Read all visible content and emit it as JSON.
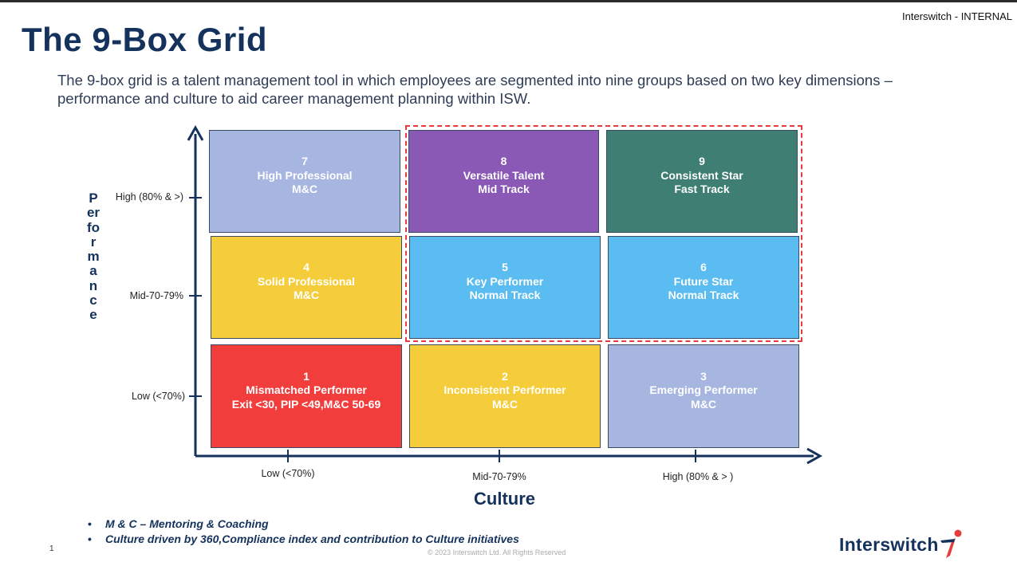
{
  "header": {
    "classification": "Interswitch - INTERNAL",
    "title": "The 9-Box Grid",
    "intro": "The 9-box grid is a talent management tool in which employees are segmented into nine groups based on two key dimensions – performance and culture to aid career management planning within ISW."
  },
  "axes": {
    "y_title": "Performance",
    "y_ticks": [
      "High (80% & >)",
      "Mid-70-79%",
      "Low (<70%)"
    ],
    "x_title": "Culture",
    "x_ticks": [
      "Low (<70%)",
      "Mid-70-79%",
      "High (80% & > )"
    ]
  },
  "boxes": [
    {
      "number": "7",
      "title": "High Professional",
      "subtitle": "M&C",
      "color": "#a7b6e1"
    },
    {
      "number": "8",
      "title": "Versatile Talent",
      "subtitle": "Mid Track",
      "color": "#8a59b5"
    },
    {
      "number": "9",
      "title": "Consistent Star",
      "subtitle": "Fast Track",
      "color": "#3f7f73"
    },
    {
      "number": "4",
      "title": "Solid Professional",
      "subtitle": "M&C",
      "color": "#f5cd3a"
    },
    {
      "number": "5",
      "title": "Key Performer",
      "subtitle": "Normal Track",
      "color": "#5abcf0"
    },
    {
      "number": "6",
      "title": "Future Star",
      "subtitle": "Normal Track",
      "color": "#5abcf0"
    },
    {
      "number": "1",
      "title": "Mismatched Performer",
      "subtitle": "Exit <30, PIP <49,M&C 50-69",
      "color": "#f23d3d"
    },
    {
      "number": "2",
      "title": "Inconsistent Performer",
      "subtitle": "M&C",
      "color": "#f5cd3a"
    },
    {
      "number": "3",
      "title": "Emerging Performer",
      "subtitle": "M&C",
      "color": "#a7b6e1"
    }
  ],
  "notes": [
    "M & C – Mentoring & Coaching",
    "Culture driven by 360,Compliance index and contribution to Culture initiatives"
  ],
  "footer": {
    "page_number": "1",
    "copyright": "© 2023 Interswitch Ltd. All Rights Reserved",
    "logo_text": "Interswitch"
  },
  "colors": {
    "navy": "#14325c",
    "highlight_border": "#e53b3b",
    "logo_accent": "#e53b3b"
  }
}
